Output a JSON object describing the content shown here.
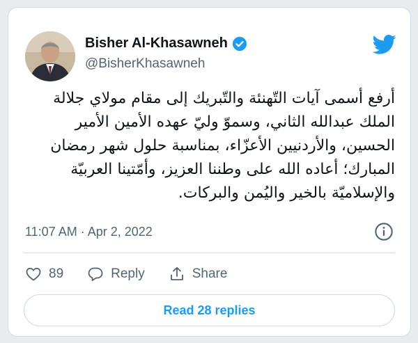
{
  "author": {
    "display_name": "Bisher Al-Khasawneh",
    "handle": "@BisherKhasawneh",
    "verified": true
  },
  "tweet": {
    "text": "أرفع أسمى آيات التّهنئة والتّبريك إلى مقام مولاي جلالة الملك عبدالله الثاني، وسموّ وليّ عهده الأمين الأمير الحسين، والأردنيين الأعزّاء، بمناسبة حلول شهر رمضان المبارك؛ أعاده الله على وطننا العزيز، وأمّتينا العربيّة والإسلاميّة بالخير واليُمن والبركات.",
    "timestamp": "11:07 AM · Apr 2, 2022"
  },
  "actions": {
    "like_count": "89",
    "reply_label": "Reply",
    "share_label": "Share"
  },
  "read_replies_label": "Read 28 replies",
  "colors": {
    "accent": "#1d9bf0",
    "text_primary": "#0f1419",
    "text_secondary": "#536471",
    "border": "#cfd9de"
  },
  "icons": [
    "twitter-bird-icon",
    "verified-badge-icon",
    "info-icon",
    "heart-icon",
    "reply-bubble-icon",
    "share-icon"
  ]
}
